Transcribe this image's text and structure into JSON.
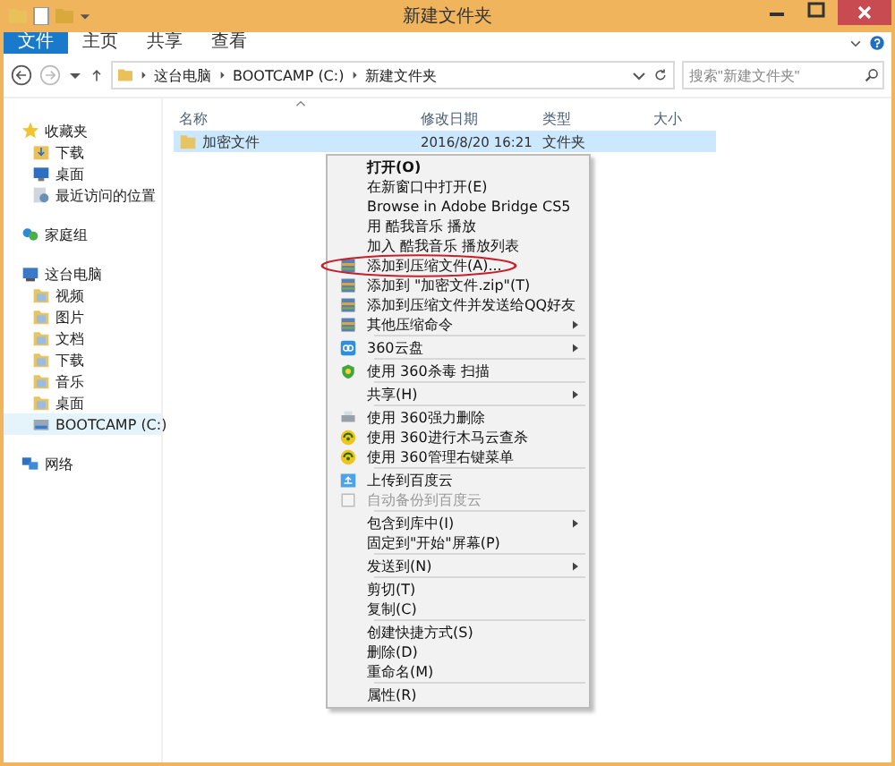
{
  "window": {
    "title": "新建文件夹"
  },
  "ribbon_tabs": [
    {
      "label": "文件",
      "kind": "file"
    },
    {
      "label": "主页",
      "kind": "tab"
    },
    {
      "label": "共享",
      "kind": "tab"
    },
    {
      "label": "查看",
      "kind": "tab"
    }
  ],
  "address": {
    "crumbs": [
      "这台电脑",
      "BOOTCAMP (C:)",
      "新建文件夹"
    ],
    "search_placeholder": "搜索\"新建文件夹\""
  },
  "sidebar": [
    {
      "label": "收藏夹",
      "selected": false,
      "children": [
        {
          "label": "下载",
          "selected": false
        },
        {
          "label": "桌面",
          "selected": false
        },
        {
          "label": "最近访问的位置",
          "selected": false
        }
      ]
    },
    {
      "label": "家庭组",
      "selected": false
    },
    {
      "label": "这台电脑",
      "selected": false,
      "children": [
        {
          "label": "视频",
          "selected": false
        },
        {
          "label": "图片",
          "selected": false
        },
        {
          "label": "文档",
          "selected": false
        },
        {
          "label": "下载",
          "selected": false
        },
        {
          "label": "音乐",
          "selected": false
        },
        {
          "label": "桌面",
          "selected": false
        },
        {
          "label": "BOOTCAMP (C:)",
          "selected": true
        }
      ]
    },
    {
      "label": "网络",
      "selected": false
    }
  ],
  "columns": [
    "名称",
    "修改日期",
    "类型",
    "大小"
  ],
  "rows": [
    {
      "name": "加密文件",
      "date": "2016/8/20 16:21",
      "type": "文件夹",
      "selected": true
    }
  ],
  "context_menu": [
    {
      "kind": "item",
      "label": "打开(O)",
      "bold": true
    },
    {
      "kind": "item",
      "label": "在新窗口中打开(E)"
    },
    {
      "kind": "item",
      "label": "Browse in Adobe Bridge CS5"
    },
    {
      "kind": "item",
      "label": "用 酷我音乐 播放"
    },
    {
      "kind": "item",
      "label": "加入 酷我音乐 播放列表"
    },
    {
      "kind": "item",
      "label": "添加到压缩文件(A)...",
      "circled": true
    },
    {
      "kind": "item",
      "label": "添加到 \"加密文件.zip\"(T)"
    },
    {
      "kind": "item",
      "label": "添加到压缩文件并发送给QQ好友"
    },
    {
      "kind": "item",
      "label": "其他压缩命令",
      "submenu": true
    },
    {
      "kind": "separator"
    },
    {
      "kind": "item",
      "label": "360云盘",
      "submenu": true
    },
    {
      "kind": "separator"
    },
    {
      "kind": "item",
      "label": "使用 360杀毒 扫描"
    },
    {
      "kind": "separator"
    },
    {
      "kind": "item",
      "label": "共享(H)",
      "submenu": true
    },
    {
      "kind": "separator"
    },
    {
      "kind": "item",
      "label": "使用 360强力删除"
    },
    {
      "kind": "item",
      "label": "使用 360进行木马云查杀"
    },
    {
      "kind": "item",
      "label": "使用 360管理右键菜单"
    },
    {
      "kind": "separator"
    },
    {
      "kind": "item",
      "label": "上传到百度云"
    },
    {
      "kind": "item",
      "label": "自动备份到百度云",
      "disabled": true
    },
    {
      "kind": "separator"
    },
    {
      "kind": "item",
      "label": "包含到库中(I)",
      "submenu": true
    },
    {
      "kind": "item",
      "label": "固定到\"开始\"屏幕(P)"
    },
    {
      "kind": "separator"
    },
    {
      "kind": "item",
      "label": "发送到(N)",
      "submenu": true
    },
    {
      "kind": "separator"
    },
    {
      "kind": "item",
      "label": "剪切(T)"
    },
    {
      "kind": "item",
      "label": "复制(C)"
    },
    {
      "kind": "separator"
    },
    {
      "kind": "item",
      "label": "创建快捷方式(S)"
    },
    {
      "kind": "item",
      "label": "删除(D)"
    },
    {
      "kind": "item",
      "label": "重命名(M)"
    },
    {
      "kind": "separator"
    },
    {
      "kind": "item",
      "label": "属性(R)"
    }
  ]
}
